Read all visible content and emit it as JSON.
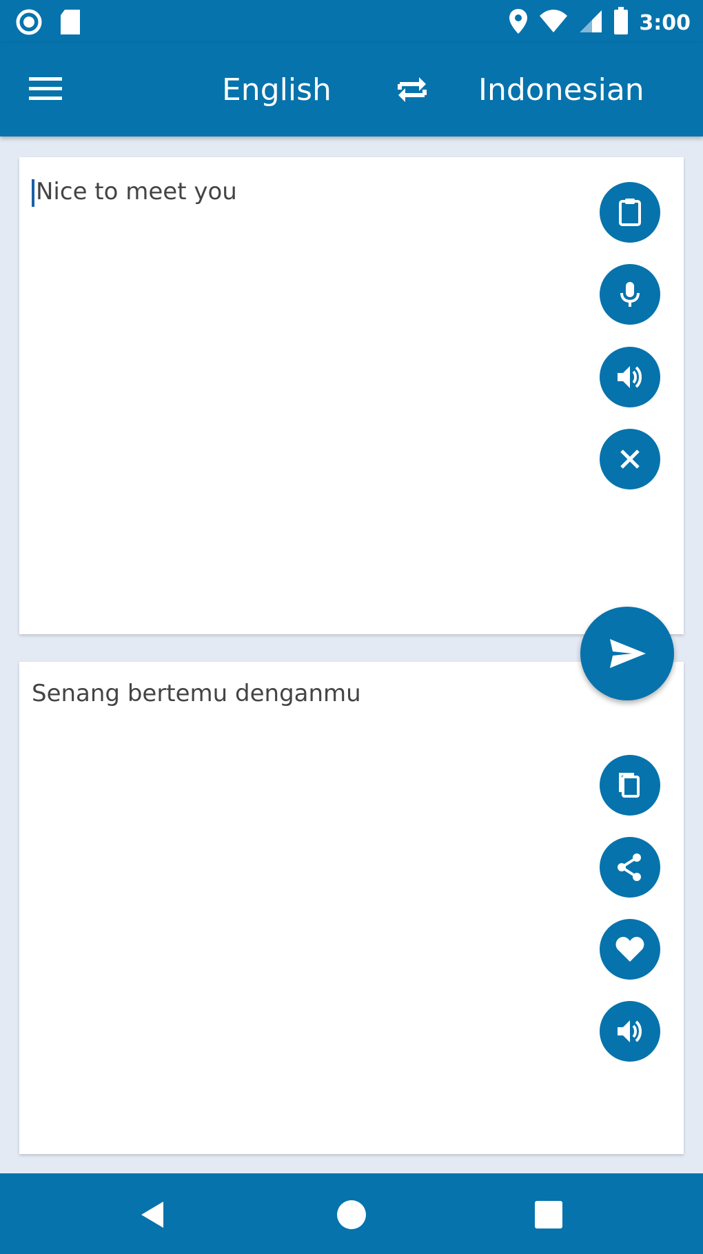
{
  "status_bar": {
    "time": "3:00",
    "left_icons": [
      "circle-status-icon",
      "sd-card-icon"
    ],
    "right_icons": [
      "location-icon",
      "wifi-icon",
      "cell-signal-icon",
      "battery-icon"
    ]
  },
  "app_bar": {
    "menu_icon": "hamburger-menu-icon",
    "source_language": "English",
    "swap_icon": "swap-languages-icon",
    "target_language": "Indonesian"
  },
  "source_panel": {
    "text": "Nice to meet you",
    "actions": [
      "clipboard-icon",
      "microphone-icon",
      "speaker-icon",
      "clear-icon"
    ]
  },
  "translate_button": {
    "icon": "send-icon"
  },
  "target_panel": {
    "text": "Senang bertemu denganmu",
    "actions": [
      "copy-icon",
      "share-icon",
      "favorite-icon",
      "speaker-icon"
    ]
  },
  "nav_bar": {
    "buttons": [
      "back-icon",
      "home-icon",
      "recents-icon"
    ]
  },
  "colors": {
    "primary": "#0673ac",
    "background": "#e4eaf4",
    "card": "#ffffff",
    "text": "#444444"
  }
}
